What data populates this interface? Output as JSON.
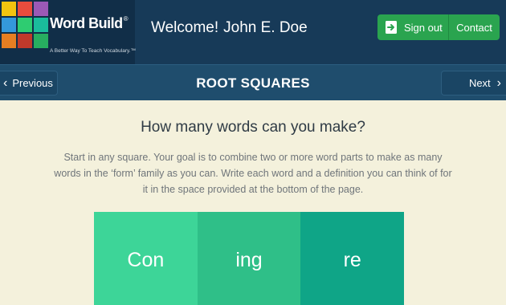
{
  "header": {
    "brand": "Word Build",
    "brand_mark": "®",
    "tagline": "A Better Way To Teach Vocabulary.™",
    "welcome": "Welcome!",
    "user_name": "John E. Doe",
    "signout_label": "Sign out",
    "contact_label": "Contact",
    "tile_colors": [
      "#f2c40f",
      "#e84c3d",
      "#9b59b6",
      "#3498db",
      "#2ecc71",
      "#1abc9c",
      "#e67e22",
      "#c0392b",
      "#27ae60"
    ]
  },
  "nav": {
    "prev_label": "Previous",
    "next_label": "Next",
    "title": "ROOT SQUARES"
  },
  "content": {
    "question": "How many words can you make?",
    "instructions": "Start in any square. Your goal is to combine two or more word parts to make as many words in the ‘form’ family as you can. Write each word and a definition you can think of for it in the space provided at the bottom of the page.",
    "squares": [
      {
        "label": "Con",
        "color": "#3dd598"
      },
      {
        "label": "ing",
        "color": "#2fbf88"
      },
      {
        "label": "re",
        "color": "#0fa587"
      }
    ]
  },
  "colors": {
    "header_bg": "#173a58",
    "nav_bg": "#1f4d6d",
    "page_bg": "#f4f1dc",
    "button_green": "#2aa44f"
  }
}
